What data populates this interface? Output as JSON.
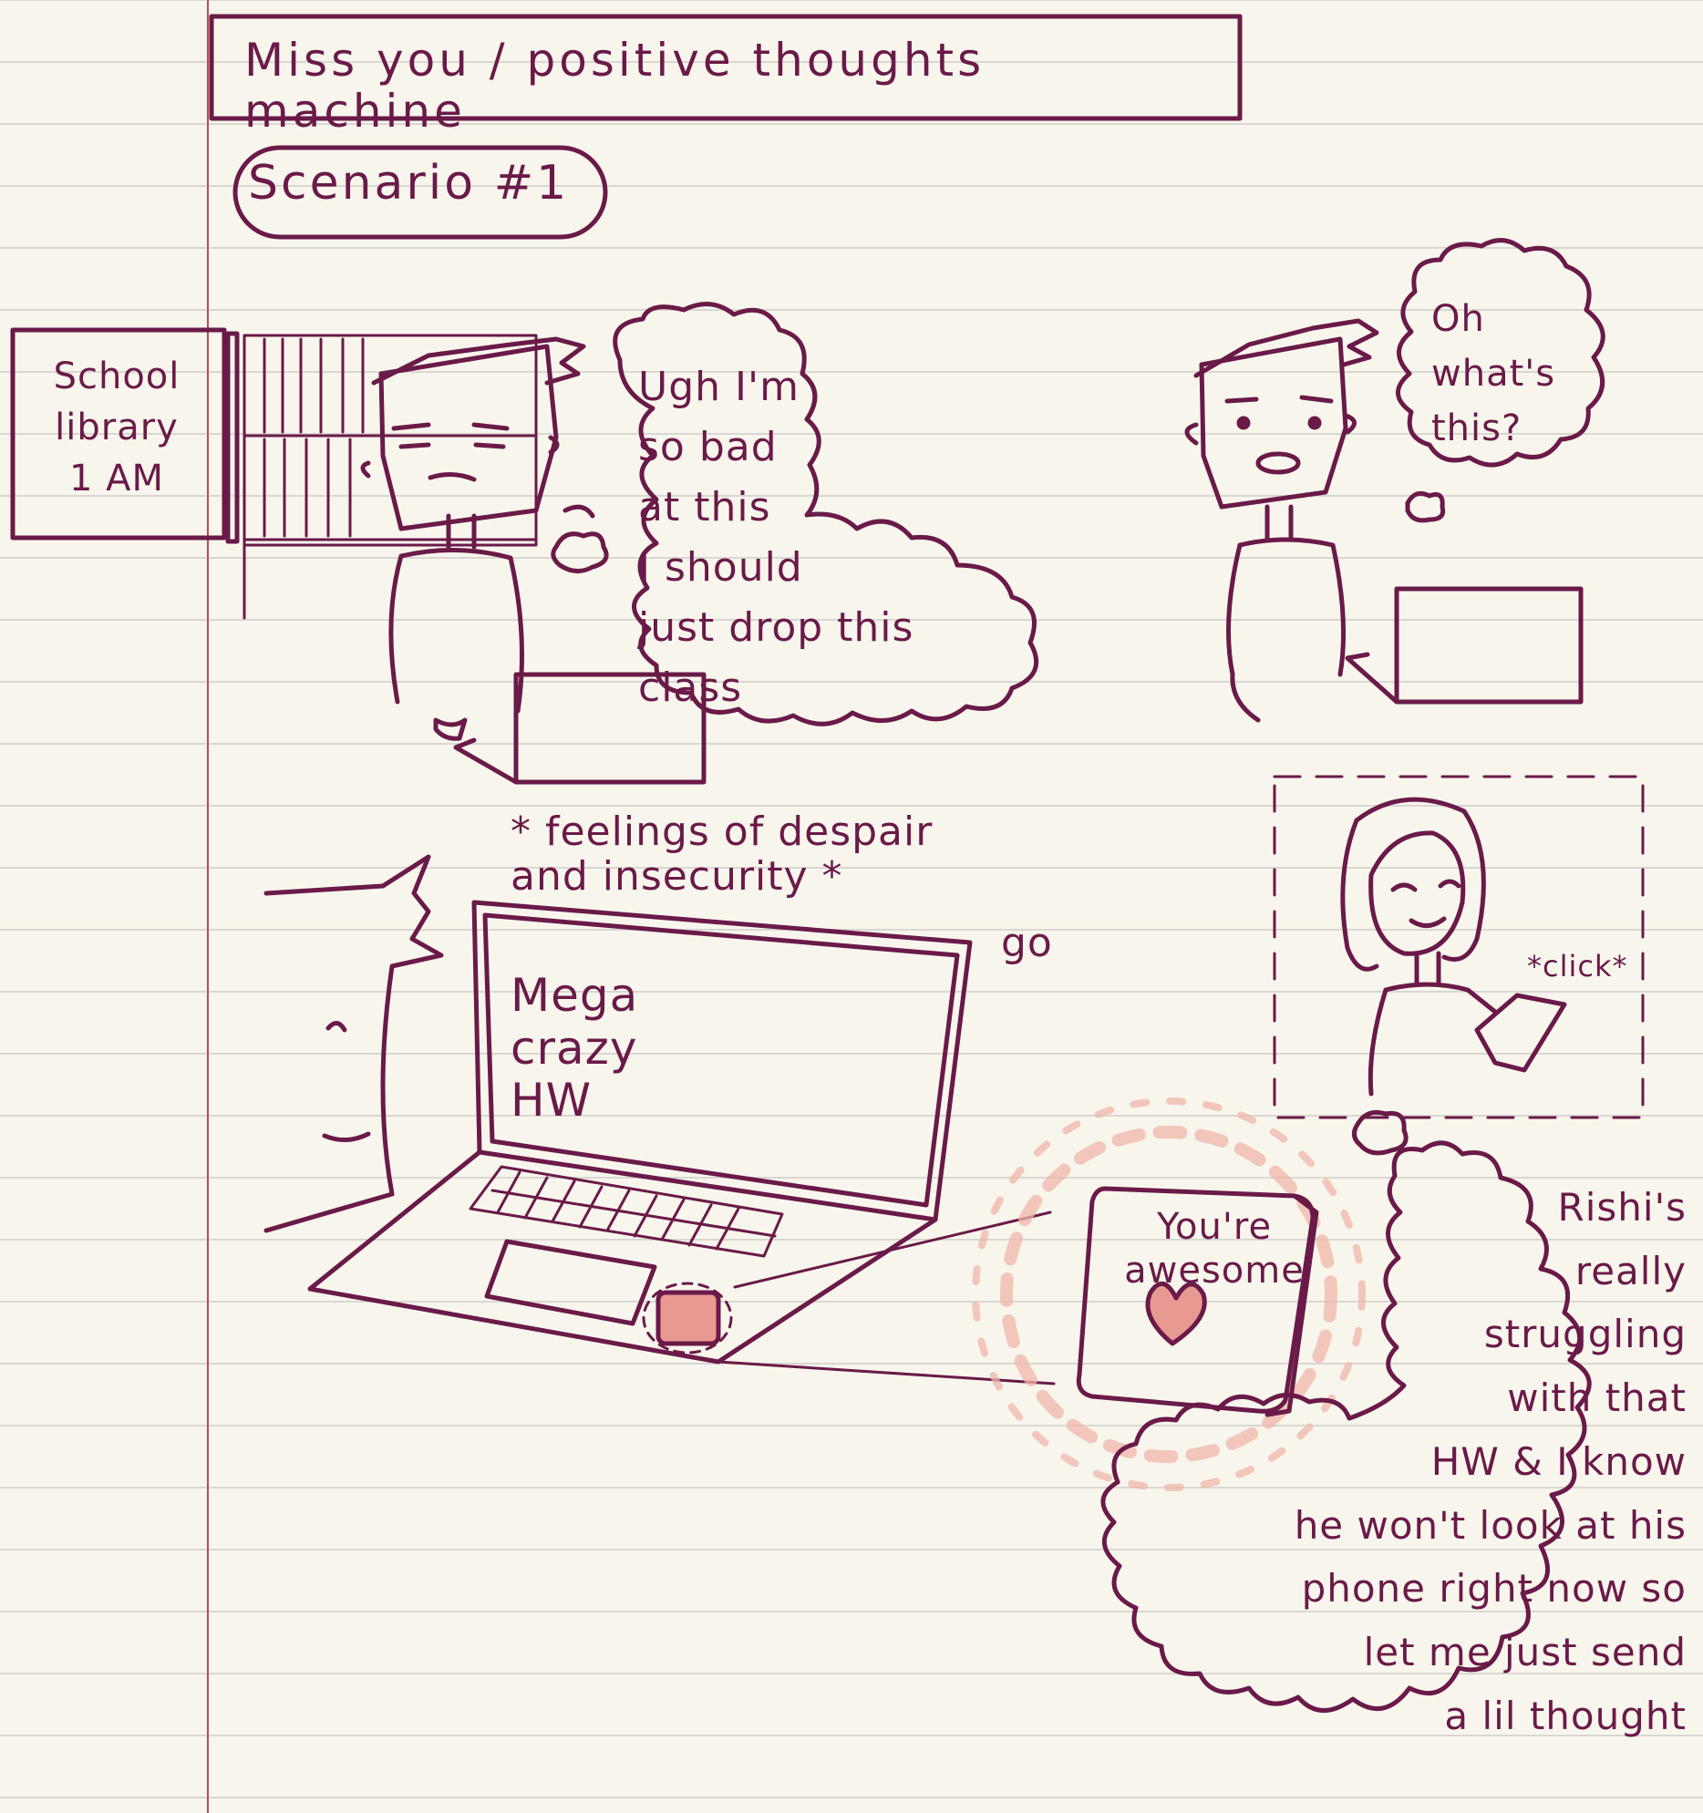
{
  "title": "Miss you / positive thoughts machine",
  "scenario_label": "Scenario #1",
  "location_sign": "School\nlibrary\n1 AM",
  "thought_bubble_1": "Ugh I'm\nso bad\nat this\nI should\njust drop this\nclass",
  "thought_bubble_2": "Oh\nwhat's\nthis?",
  "feelings_caption": "* feelings of despair\nand insecurity *",
  "feelings_go": "go",
  "laptop_screen_text": "Mega\ncrazy\nHW",
  "click_caption": "*click*",
  "device_text": "You're\nawesome",
  "thought_bubble_3": "Rishi's\nreally\nstruggling\nwith that\nHW & I know\nhe won't look at his\nphone right now so\nlet me just send\na lil thought",
  "colors": {
    "ink": "#6a1a48",
    "paper": "#f8f6ec",
    "rule_line": "#d9d7d2",
    "margin_line": "#c44a4a",
    "heart_fill": "#e89a92",
    "glow": "#f0b6aa"
  },
  "icons": [
    "heart-icon"
  ]
}
